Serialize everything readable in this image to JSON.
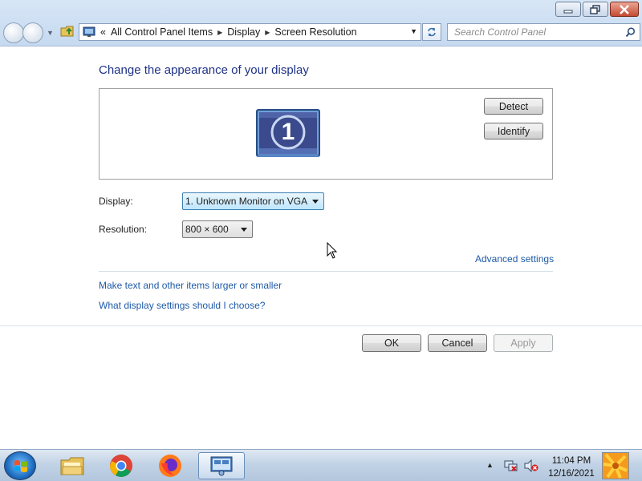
{
  "address": {
    "overflow": "«",
    "crumbs": [
      "All Control Panel Items",
      "Display",
      "Screen Resolution"
    ]
  },
  "search": {
    "placeholder": "Search Control Panel"
  },
  "main": {
    "heading": "Change the appearance of your display",
    "monitor_number": "1",
    "detect_label": "Detect",
    "identify_label": "Identify",
    "display_label": "Display:",
    "display_value": "1. Unknown Monitor on VGA",
    "resolution_label": "Resolution:",
    "resolution_value": "800 × 600",
    "advanced_link": "Advanced settings",
    "link_text_larger": "Make text and other items larger or smaller",
    "link_which_settings": "What display settings should I choose?",
    "ok_label": "OK",
    "cancel_label": "Cancel",
    "apply_label": "Apply"
  },
  "taskbar": {
    "pinned": [
      "windows-explorer-icon",
      "chrome-icon",
      "firefox-icon",
      "screen-resolution-window-icon"
    ],
    "time": "11:04 PM",
    "date": "12/16/2021"
  },
  "colors": {
    "heading": "#1e3287",
    "link": "#1e5aa8",
    "chrome_bar": "#c5d9f0"
  }
}
